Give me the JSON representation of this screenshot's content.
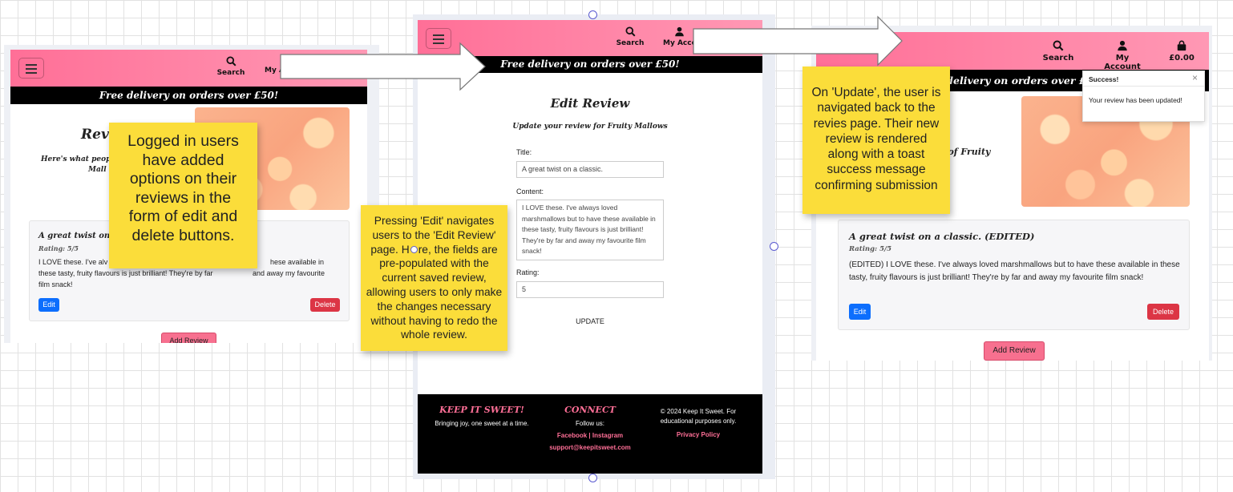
{
  "nav": {
    "search_label": "Search",
    "account_label": "My Account",
    "account_label_clipped": "My A",
    "account_label_clipped_mid": "My Acco",
    "basket_total": "£0.00"
  },
  "banner": {
    "text": "Free delivery on orders over £50!",
    "text_clipped": "e delivery on orders over £"
  },
  "screen1": {
    "title_clipped": "Revie",
    "subtitle_clipped": "Here's what people",
    "subtitle_clipped_2": "Mall",
    "review": {
      "title_clipped": "A great twist on a c",
      "rating": "Rating: 5/5",
      "body_line1_left": "I LOVE these. I've alv",
      "body_line1_right": "hese available in",
      "body_line2_left": "these tasty, fruity flavours is just brilliant! They're by far",
      "body_line2_right": "and away my favourite",
      "body_line3": "film snack!"
    },
    "edit_label": "Edit",
    "delete_label": "Delete",
    "add_review_label": "Add Review"
  },
  "screen2": {
    "heading": "Edit Review",
    "subheading": "Update your review for Fruity Mallows",
    "title_label": "Title:",
    "title_value": "A great twist on a classic.",
    "content_label": "Content:",
    "content_value": "I LOVE these. I've always loved marshmallows but to have these available in these tasty, fruity flavours is just brilliant! They're by far and away my favourite film snack!",
    "rating_label": "Rating:",
    "rating_value": "5",
    "update_label": "UPDATE",
    "footer": {
      "brand": "KEEP IT SWEET!",
      "tagline": "Bringing joy, one sweet at a time.",
      "connect_heading": "CONNECT",
      "follow_label": "Follow us:",
      "facebook": "Facebook",
      "separator": " | ",
      "instagram": "Instagram",
      "email": "support@keepitsweet.com",
      "copyright": "© 2024 Keep It Sweet. For educational purposes only.",
      "privacy": "Privacy Policy"
    }
  },
  "screen3": {
    "subtitle_clipped": "k of Fruity",
    "review": {
      "title": "A great twist on a classic. (EDITED)",
      "rating": "Rating: 5/5",
      "body": "(EDITED) I LOVE these. I've always loved marshmallows but to have these available in these tasty, fruity flavours is just brilliant! They're by far and away my favourite film snack!"
    },
    "edit_label": "Edit",
    "delete_label": "Delete",
    "add_review_label": "Add Review",
    "toast": {
      "title": "Success!",
      "message": "Your review has been updated!",
      "close": "×"
    }
  },
  "notes": {
    "note1": "Logged in users have added options on their reviews in the form of edit and delete buttons.",
    "note2_line1": "Pressing 'Edit' navigates",
    "note2_line2": "users to the 'Edit Review'",
    "note2_line3_a": "page. H",
    "note2_line3_b": "re, the fields are",
    "note2_rest": "pre-populated with the current saved review, allowing users to only make the changes necessary without having to redo the whole review.",
    "note3": "On 'Update', the user is navigated back to the revies page. Their new review is rendered along with a toast success message confirming submission"
  },
  "colors": {
    "brand_pink": "#ff6f97",
    "sticky_yellow": "#fbdd3a",
    "edit_blue": "#0d6efd",
    "delete_red": "#dc3545"
  },
  "icons": [
    "search-icon",
    "user-icon",
    "bag-icon",
    "menu-icon",
    "arrow-right-icon",
    "close-icon"
  ]
}
